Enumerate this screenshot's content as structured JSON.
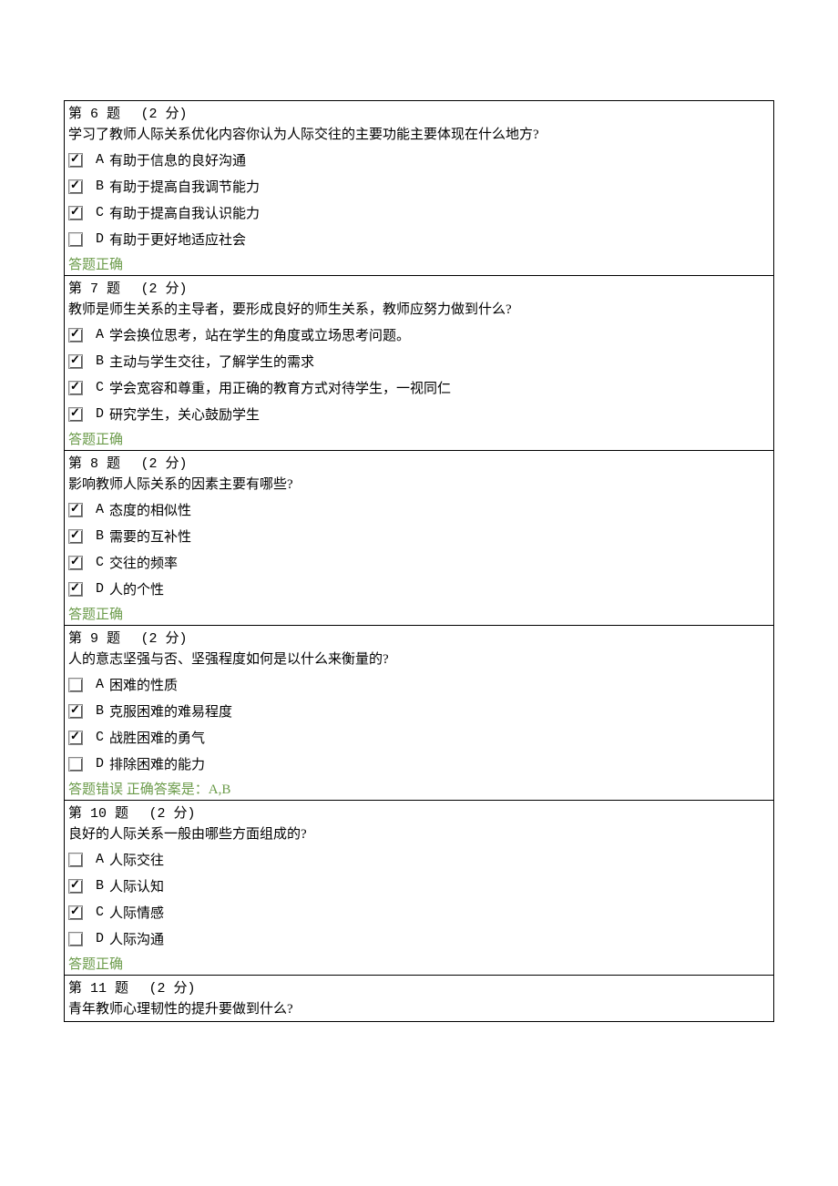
{
  "result_correct_label": "答题正确",
  "result_wrong_prefix": "答题错误 正确答案是：",
  "questions": [
    {
      "num": "第 6 题",
      "points": "(2 分)",
      "stem": "学习了教师人际关系优化内容你认为人际交往的主要功能主要体现在什么地方?",
      "options": [
        {
          "letter": "A",
          "text": "有助于信息的良好沟通",
          "checked": true
        },
        {
          "letter": "B",
          "text": "有助于提高自我调节能力",
          "checked": true
        },
        {
          "letter": "C",
          "text": "有助于提高自我认识能力",
          "checked": true
        },
        {
          "letter": "D",
          "text": "有助于更好地适应社会",
          "checked": false
        }
      ],
      "result": {
        "correct": true,
        "correct_answer": ""
      }
    },
    {
      "num": "第 7 题",
      "points": "(2 分)",
      "stem": "教师是师生关系的主导者，要形成良好的师生关系，教师应努力做到什么?",
      "options": [
        {
          "letter": "A",
          "text": "学会换位思考，站在学生的角度或立场思考问题。",
          "checked": true
        },
        {
          "letter": "B",
          "text": "主动与学生交往，了解学生的需求",
          "checked": true
        },
        {
          "letter": "C",
          "text": "学会宽容和尊重，用正确的教育方式对待学生，一视同仁",
          "checked": true
        },
        {
          "letter": "D",
          "text": "研究学生，关心鼓励学生",
          "checked": true
        }
      ],
      "result": {
        "correct": true,
        "correct_answer": ""
      }
    },
    {
      "num": "第 8 题",
      "points": "(2 分)",
      "stem": "影响教师人际关系的因素主要有哪些?",
      "options": [
        {
          "letter": "A",
          "text": "态度的相似性",
          "checked": true
        },
        {
          "letter": "B",
          "text": "需要的互补性",
          "checked": true
        },
        {
          "letter": "C",
          "text": "交往的频率",
          "checked": true
        },
        {
          "letter": "D",
          "text": "人的个性",
          "checked": true
        }
      ],
      "result": {
        "correct": true,
        "correct_answer": ""
      }
    },
    {
      "num": "第 9 题",
      "points": "(2 分)",
      "stem": "人的意志坚强与否、坚强程度如何是以什么来衡量的?",
      "options": [
        {
          "letter": "A",
          "text": "困难的性质",
          "checked": false
        },
        {
          "letter": "B",
          "text": "克服困难的难易程度",
          "checked": true
        },
        {
          "letter": "C",
          "text": "战胜困难的勇气",
          "checked": true
        },
        {
          "letter": "D",
          "text": "排除困难的能力",
          "checked": false
        }
      ],
      "result": {
        "correct": false,
        "correct_answer": "A,B"
      }
    },
    {
      "num": "第 10 题",
      "points": "(2 分)",
      "stem": "良好的人际关系一般由哪些方面组成的?",
      "options": [
        {
          "letter": "A",
          "text": "人际交往",
          "checked": false
        },
        {
          "letter": "B",
          "text": "人际认知",
          "checked": true
        },
        {
          "letter": "C",
          "text": "人际情感",
          "checked": true
        },
        {
          "letter": "D",
          "text": "人际沟通",
          "checked": false
        }
      ],
      "result": {
        "correct": true,
        "correct_answer": ""
      }
    },
    {
      "num": "第 11 题",
      "points": "(2 分)",
      "stem": "青年教师心理韧性的提升要做到什么?",
      "options": [],
      "result": null
    }
  ]
}
